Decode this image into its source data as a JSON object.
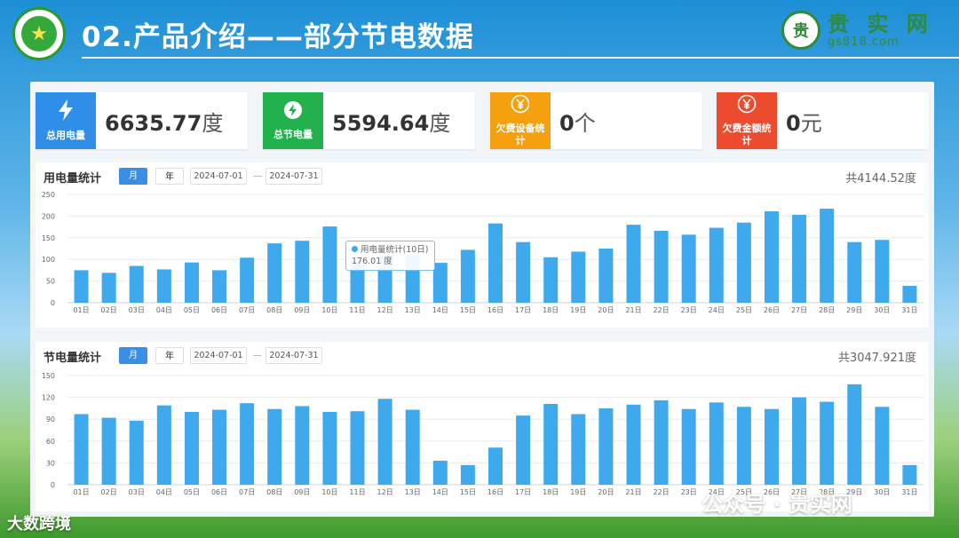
{
  "header": {
    "title": "02.产品介绍——部分节电数据",
    "brand_cn": "贵 实 网",
    "brand_en": "gs818.com"
  },
  "cards": [
    {
      "label": "总用电量",
      "value": "6635.77",
      "unit": "度",
      "color": "#2f8ee8",
      "icon": "lightning-icon"
    },
    {
      "label": "总节电量",
      "value": "5594.64",
      "unit": "度",
      "color": "#23b14d",
      "icon": "leaf-bolt-icon"
    },
    {
      "label": "欠费设备统计",
      "value": "0",
      "unit": "个",
      "color": "#f5a00f",
      "icon": "yen-icon"
    },
    {
      "label": "欠费金额统计",
      "value": "0",
      "unit": "元",
      "color": "#ec4b2e",
      "icon": "yen-icon"
    }
  ],
  "controls": {
    "month_label": "月",
    "year_label": "年",
    "date_start": "2024-07-01",
    "date_sep": "—",
    "date_end": "2024-07-31"
  },
  "tooltip": {
    "series": "用电量统计(10日)",
    "value": "176.01 度"
  },
  "watermarks": {
    "wechat": "公众号 · 贵实网",
    "corner": "大数跨境"
  },
  "colors": {
    "bar": "#3ea9ec",
    "grid": "#e8ebee",
    "axis_text": "#666666"
  },
  "chart_data": [
    {
      "type": "bar",
      "title": "用电量统计",
      "total": "共4144.52度",
      "categories": [
        "01日",
        "02日",
        "03日",
        "04日",
        "05日",
        "06日",
        "07日",
        "08日",
        "09日",
        "10日",
        "11日",
        "12日",
        "13日",
        "14日",
        "15日",
        "16日",
        "17日",
        "18日",
        "19日",
        "20日",
        "21日",
        "22日",
        "23日",
        "24日",
        "25日",
        "26日",
        "27日",
        "28日",
        "29日",
        "30日",
        "31日"
      ],
      "values": [
        75,
        69,
        85,
        77,
        93,
        75,
        104,
        137,
        143,
        176.01,
        98,
        108,
        111,
        92,
        122,
        183,
        140,
        105,
        118,
        125,
        180,
        166,
        157,
        173,
        185,
        211,
        203,
        217,
        140,
        145,
        39
      ],
      "yticks": [
        0,
        50,
        100,
        150,
        200,
        250
      ],
      "ylim": [
        0,
        250
      ],
      "grid": true
    },
    {
      "type": "bar",
      "title": "节电量统计",
      "total": "共3047.921度",
      "categories": [
        "01日",
        "02日",
        "03日",
        "04日",
        "05日",
        "06日",
        "07日",
        "08日",
        "09日",
        "10日",
        "11日",
        "12日",
        "13日",
        "14日",
        "15日",
        "16日",
        "17日",
        "18日",
        "19日",
        "20日",
        "21日",
        "22日",
        "23日",
        "24日",
        "25日",
        "26日",
        "27日",
        "28日",
        "29日",
        "30日",
        "31日"
      ],
      "values": [
        97,
        92,
        88,
        109,
        100,
        103,
        112,
        104,
        108,
        100,
        101,
        118,
        103,
        33,
        27,
        51,
        95,
        111,
        97,
        105,
        110,
        116,
        104,
        113,
        107,
        104,
        120,
        114,
        138,
        107,
        27
      ],
      "yticks": [
        0,
        30,
        60,
        90,
        120,
        150
      ],
      "ylim": [
        0,
        150
      ],
      "grid": true
    }
  ]
}
